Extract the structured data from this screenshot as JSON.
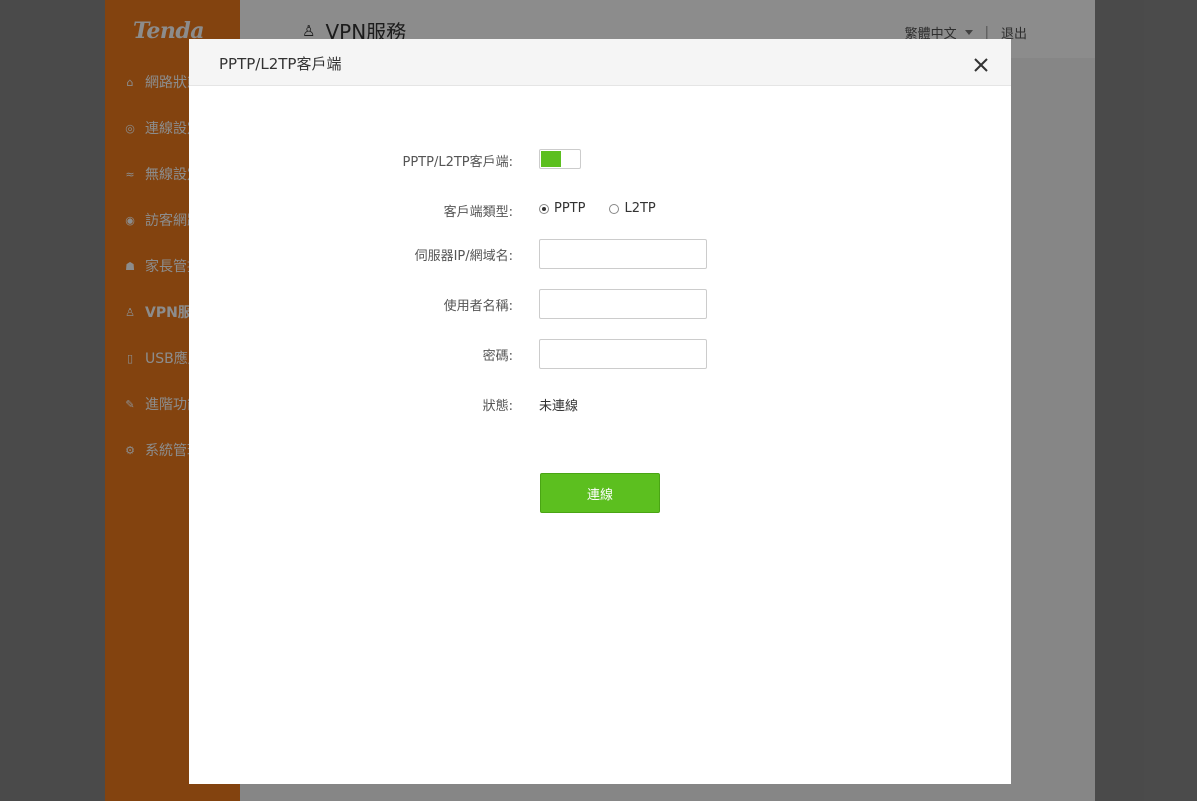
{
  "brand": {
    "logo": "Tenda",
    "accent": "#ef7b1c",
    "green": "#5cbf1f"
  },
  "sidebar": {
    "items": [
      {
        "label": "網路狀態",
        "icon": "network-status-icon"
      },
      {
        "label": "連線設定",
        "icon": "globe-icon"
      },
      {
        "label": "無線設定",
        "icon": "wifi-icon"
      },
      {
        "label": "訪客網路",
        "icon": "guest-icon"
      },
      {
        "label": "家長管控",
        "icon": "parental-icon"
      },
      {
        "label": "VPN服務",
        "icon": "vpn-icon",
        "active": true
      },
      {
        "label": "USB應用",
        "icon": "usb-icon"
      },
      {
        "label": "進階功能",
        "icon": "wrench-icon"
      },
      {
        "label": "系統管理",
        "icon": "gear-icon"
      }
    ]
  },
  "header": {
    "title": "VPN服務",
    "language": "繁體中文",
    "separator": "|",
    "logout": "退出"
  },
  "dialog": {
    "title": "PPTP/L2TP客戶端",
    "client_label": "PPTP/L2TP客戶端:",
    "client_enabled": true,
    "type_label": "客戶端類型:",
    "type_options": [
      "PPTP",
      "L2TP"
    ],
    "type_selected": "PPTP",
    "server_label": "伺服器IP/網域名:",
    "server_value": "",
    "username_label": "使用者名稱:",
    "username_value": "",
    "password_label": "密碼:",
    "password_value": "",
    "status_label": "狀態:",
    "status_value": "未連線",
    "connect_button": "連線"
  }
}
